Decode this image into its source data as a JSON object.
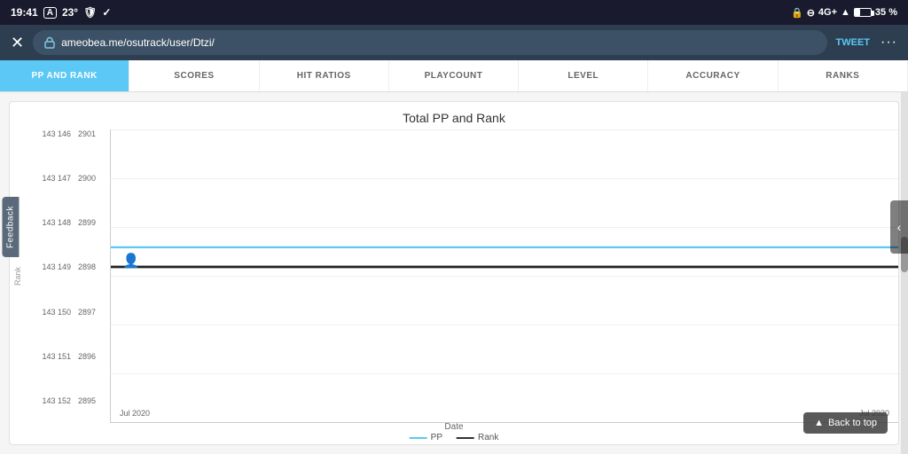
{
  "statusBar": {
    "time": "19:41",
    "icons": [
      "A",
      "23°",
      "shield",
      "check"
    ],
    "rightIcons": [
      "lock",
      "circle",
      "4G+",
      "wifi"
    ],
    "battery": "35 %"
  },
  "browser": {
    "url": "ameobea.me/osutrack/user/Dtzi/",
    "tweetLabel": "TWEET",
    "menuIcon": "···"
  },
  "navTabs": [
    {
      "id": "pp-and-rank",
      "label": "PP AND RANK",
      "active": true
    },
    {
      "id": "scores",
      "label": "SCORES",
      "active": false
    },
    {
      "id": "hit-ratios",
      "label": "HIT RATIOS",
      "active": false
    },
    {
      "id": "playcount",
      "label": "PLAYCOUNT",
      "active": false
    },
    {
      "id": "level",
      "label": "LEVEL",
      "active": false
    },
    {
      "id": "accuracy",
      "label": "ACCURACY",
      "active": false
    },
    {
      "id": "ranks",
      "label": "RANKS",
      "active": false
    }
  ],
  "chart": {
    "title": "Total PP and Rank",
    "yAxisPP": [
      "143 146",
      "143 147",
      "143 148",
      "143 149",
      "143 150",
      "143 151",
      "143 152"
    ],
    "yAxisRank": [
      "2901",
      "2900",
      "2899",
      "2898",
      "2897",
      "2896",
      "2895"
    ],
    "xLabels": [
      "Jul 2020",
      "Jul 2020"
    ],
    "dateLabel": "Date",
    "legend": {
      "ppLabel": "PP",
      "rankLabel": "Rank"
    },
    "rankAxisLabel": "Rank"
  },
  "backToTop": {
    "label": "Back to top"
  },
  "feedback": {
    "label": "Feedback"
  }
}
